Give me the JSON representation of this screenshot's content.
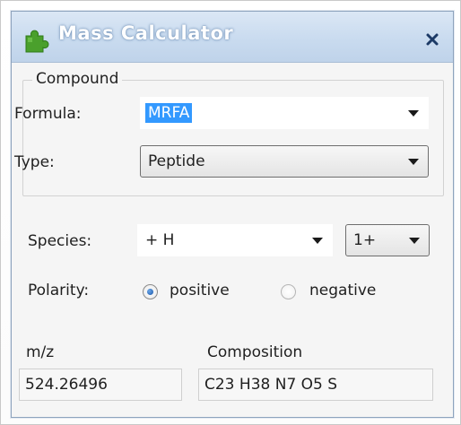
{
  "window": {
    "title": "Mass Calculator",
    "icon": "puzzle-piece-icon",
    "close": "close-icon",
    "colors": {
      "title_bar": "#c9dbef",
      "icon_green": "#4aa02c",
      "close_x": "#1c3a66"
    }
  },
  "compound": {
    "legend": "Compound",
    "formula_label": "Formula:",
    "formula_value": "MRFA",
    "type_label": "Type:",
    "type_value": "Peptide"
  },
  "species": {
    "label": "Species:",
    "value": "+ H",
    "charge": "1+"
  },
  "polarity": {
    "label": "Polarity:",
    "options": [
      {
        "label": "positive",
        "selected": true
      },
      {
        "label": "negative",
        "selected": false
      }
    ]
  },
  "results": {
    "mz_label": "m/z",
    "mz_value": "524.26496",
    "composition_label": "Composition",
    "composition_value": "C23 H38 N7 O5 S"
  }
}
